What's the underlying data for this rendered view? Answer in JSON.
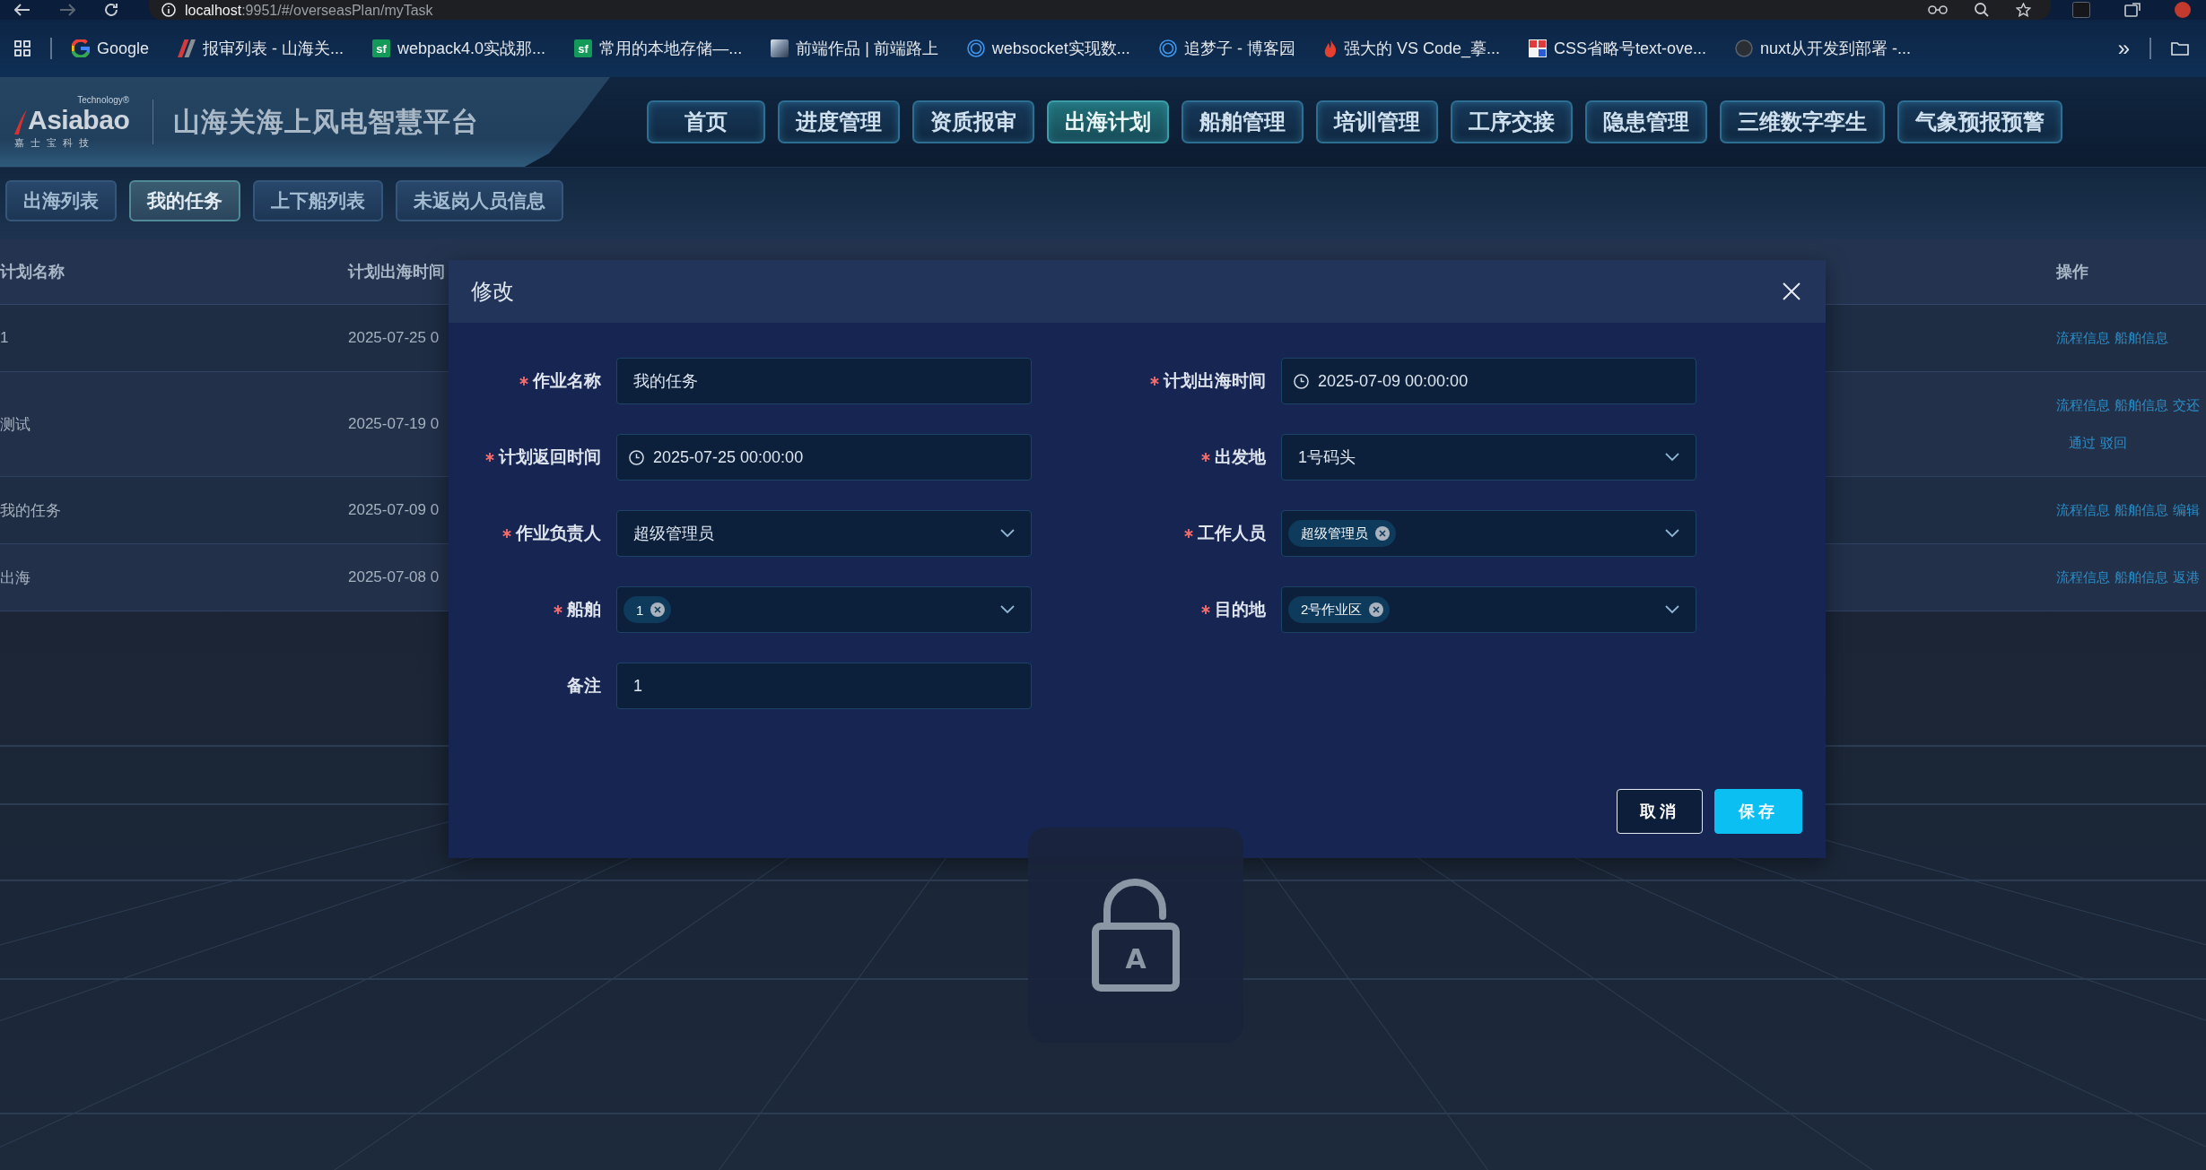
{
  "browser": {
    "url": {
      "host": "localhost",
      "path": ":9951/#/overseasPlan/myTask"
    },
    "bookmarks": [
      {
        "label": "Google",
        "favicon": {
          "kind": "google"
        }
      },
      {
        "label": "报审列表 - 山海关...",
        "favicon": {
          "kind": "slash"
        }
      },
      {
        "label": "webpack4.0实战那...",
        "favicon": {
          "kind": "letters",
          "text": "sf"
        }
      },
      {
        "label": "常用的本地存储—...",
        "favicon": {
          "kind": "letters",
          "text": "sf"
        }
      },
      {
        "label": "前端作品 | 前端路上",
        "favicon": {
          "kind": "photo"
        }
      },
      {
        "label": "websocket实现数...",
        "favicon": {
          "kind": "ring"
        }
      },
      {
        "label": "追梦子 - 博客园",
        "favicon": {
          "kind": "ring"
        }
      },
      {
        "label": "强大的 VS Code_摹...",
        "favicon": {
          "kind": "flame"
        }
      },
      {
        "label": "CSS省略号text-ove...",
        "favicon": {
          "kind": "blocks"
        }
      },
      {
        "label": "nuxt从开发到部署 -...",
        "favicon": {
          "kind": "cat"
        }
      }
    ],
    "overflow": "»"
  },
  "header": {
    "logo": {
      "tagline": "Technology®",
      "wordmark": "Asiabao",
      "subtitle": "嘉 士 宝 科 技"
    },
    "title": "山海关海上风电智慧平台",
    "nav": [
      {
        "label": "首页",
        "selected": false
      },
      {
        "label": "进度管理",
        "selected": false
      },
      {
        "label": "资质报审",
        "selected": false
      },
      {
        "label": "出海计划",
        "selected": true
      },
      {
        "label": "船舶管理",
        "selected": false
      },
      {
        "label": "培训管理",
        "selected": false
      },
      {
        "label": "工序交接",
        "selected": false
      },
      {
        "label": "隐患管理",
        "selected": false
      },
      {
        "label": "三维数字孪生",
        "selected": false
      },
      {
        "label": "气象预报预警",
        "selected": false
      }
    ]
  },
  "subtabs": [
    {
      "label": "出海列表",
      "selected": false
    },
    {
      "label": "我的任务",
      "selected": true
    },
    {
      "label": "上下船列表",
      "selected": false
    },
    {
      "label": "未返岗人员信息",
      "selected": false
    }
  ],
  "table": {
    "columns": [
      "计划名称",
      "计划出海时间",
      "操作"
    ],
    "rows": [
      {
        "name": "1",
        "departure": "2025-07-25 0",
        "actions": [
          "流程信息",
          "船舶信息"
        ]
      },
      {
        "name": "测试",
        "departure": "2025-07-19 0",
        "actions": [
          "流程信息",
          "船舶信息",
          "交还"
        ],
        "review_actions": [
          "通过",
          "驳回"
        ]
      },
      {
        "name": "我的任务",
        "departure": "2025-07-09 0",
        "actions": [
          "流程信息",
          "船舶信息",
          "编辑"
        ]
      },
      {
        "name": "出海",
        "departure": "2025-07-08 0",
        "actions": [
          "流程信息",
          "船舶信息",
          "返港"
        ]
      }
    ]
  },
  "dialog": {
    "title": "修改",
    "fields": [
      {
        "kind": "text",
        "label": "作业名称",
        "required": true,
        "value": "我的任务"
      },
      {
        "kind": "date",
        "label": "计划出海时间",
        "required": true,
        "value": "2025-07-09 00:00:00"
      },
      {
        "kind": "date",
        "label": "计划返回时间",
        "required": true,
        "value": "2025-07-25 00:00:00"
      },
      {
        "kind": "select",
        "label": "出发地",
        "required": true,
        "value": "1号码头"
      },
      {
        "kind": "select",
        "label": "作业负责人",
        "required": true,
        "value": "超级管理员"
      },
      {
        "kind": "tags",
        "label": "工作人员",
        "required": true,
        "tags": [
          "超级管理员"
        ]
      },
      {
        "kind": "tags",
        "label": "船舶",
        "required": true,
        "tags": [
          "1"
        ]
      },
      {
        "kind": "tags",
        "label": "目的地",
        "required": true,
        "tags": [
          "2号作业区"
        ]
      },
      {
        "kind": "text",
        "label": "备注",
        "required": false,
        "value": "1"
      }
    ],
    "buttons": [
      {
        "label": "取消",
        "kind": "cancel"
      },
      {
        "label": "保存",
        "kind": "primary"
      }
    ]
  },
  "lock_overlay": {
    "letter": "A"
  }
}
